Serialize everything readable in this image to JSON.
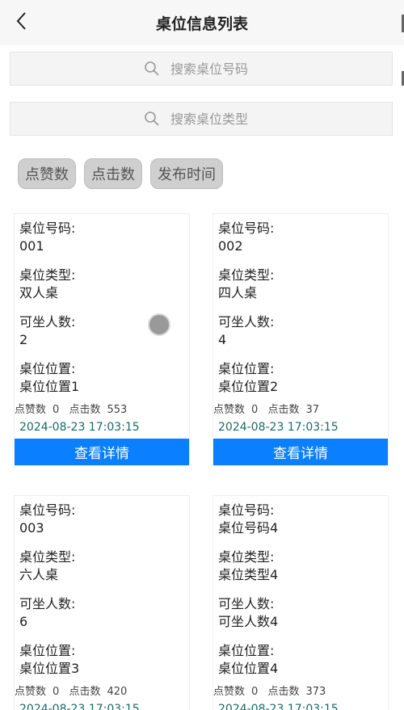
{
  "header": {
    "title": "桌位信息列表"
  },
  "search": {
    "number_placeholder": "搜索桌位号码",
    "type_placeholder": "搜索桌位类型"
  },
  "sort": {
    "likes": "点赞数",
    "clicks": "点击数",
    "time": "发布时间"
  },
  "labels": {
    "number": "桌位号码:",
    "type": "桌位类型:",
    "seats": "可坐人数:",
    "location": "桌位位置:",
    "likes": "点赞数",
    "clicks": "点击数",
    "detail": "查看详情"
  },
  "cards": [
    {
      "number": "001",
      "type": "双人桌",
      "seats": "2",
      "location": "桌位位置1",
      "likes": "0",
      "clicks": "553",
      "time": "2024-08-23 17:03:15"
    },
    {
      "number": "002",
      "type": "四人桌",
      "seats": "4",
      "location": "桌位位置2",
      "likes": "0",
      "clicks": "37",
      "time": "2024-08-23 17:03:15"
    },
    {
      "number": "003",
      "type": "六人桌",
      "seats": "6",
      "location": "桌位位置3",
      "likes": "0",
      "clicks": "420",
      "time": "2024-08-23 17:03:15"
    },
    {
      "number": "桌位号码4",
      "type": "桌位类型4",
      "seats": "可坐人数4",
      "location": "桌位位置4",
      "likes": "0",
      "clicks": "373",
      "time": "2024-08-23 17:03:15"
    }
  ]
}
